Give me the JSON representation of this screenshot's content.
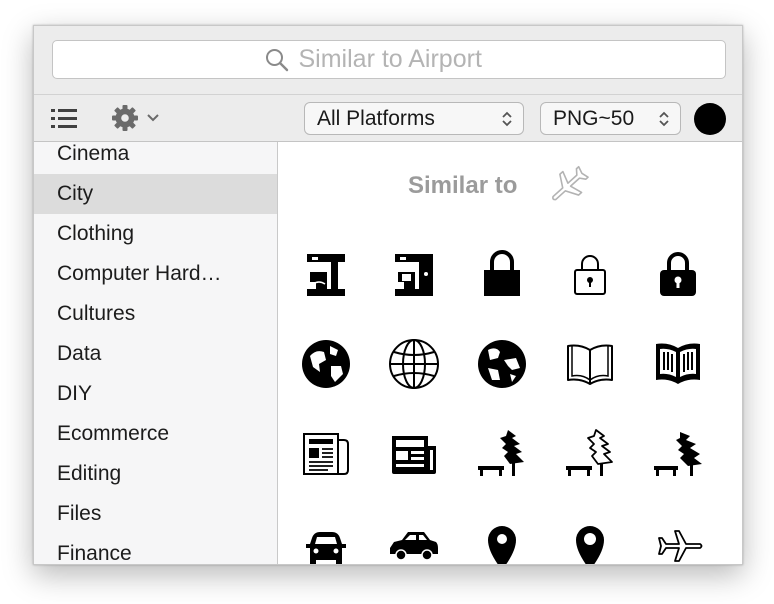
{
  "search": {
    "placeholder": "Similar to Airport",
    "icon": "search-icon"
  },
  "toolbar": {
    "list_view_icon": "list-icon",
    "settings_icon": "gear-icon",
    "platform": {
      "selected": "All Platforms"
    },
    "format": {
      "selected": "PNG~50"
    },
    "color": "#000000"
  },
  "sidebar": {
    "items": [
      {
        "label": "Cinema"
      },
      {
        "label": "City",
        "selected": true
      },
      {
        "label": "Clothing"
      },
      {
        "label": "Computer Hard…"
      },
      {
        "label": "Cultures"
      },
      {
        "label": "Data"
      },
      {
        "label": "DIY"
      },
      {
        "label": "Ecommerce"
      },
      {
        "label": "Editing"
      },
      {
        "label": "Files"
      },
      {
        "label": "Finance"
      }
    ]
  },
  "content": {
    "heading": "Similar to",
    "heading_icon": "airplane-outline-icon",
    "icons": [
      [
        "coffee-maker-icon",
        "coffee-maker-filled-icon",
        "padlock-filled-icon",
        "padlock-outline-icon",
        "padlock-keyhole-icon"
      ],
      [
        "globe-filled-icon",
        "globe-outline-icon",
        "earth-icon",
        "open-book-outline-icon",
        "open-book-filled-icon"
      ],
      [
        "newspaper-outline-icon",
        "newspaper-filled-icon",
        "park-tree-bench-icon",
        "park-tree-bench-outline-icon",
        "park-tree-bench-solid-icon"
      ],
      [
        "car-front-icon",
        "car-side-icon",
        "map-pin-icon",
        "map-pin-alt-icon",
        "airplane-outline-icon"
      ]
    ]
  }
}
